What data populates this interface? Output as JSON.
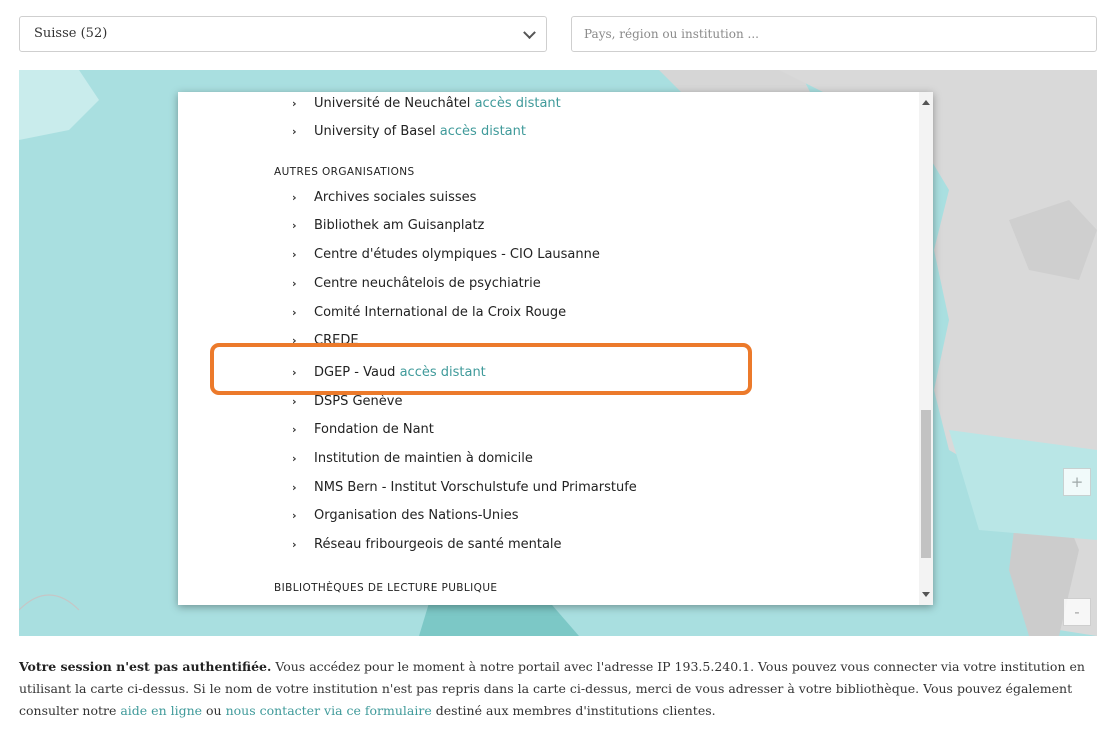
{
  "country_select": {
    "value": "Suisse (52)"
  },
  "search": {
    "placeholder": "Pays, région ou institution ..."
  },
  "map": {
    "zoom_in": "+",
    "zoom_out": "-"
  },
  "popup": {
    "items_top": [
      {
        "name": "Université de Neuchâtel",
        "remote": "accès distant"
      },
      {
        "name": "University of Basel",
        "remote": "accès distant"
      }
    ],
    "section_other": "AUTRES ORGANISATIONS",
    "items_other": [
      {
        "name": "Archives sociales suisses",
        "remote": ""
      },
      {
        "name": "Bibliothek am Guisanplatz",
        "remote": ""
      },
      {
        "name": "Centre d'études olympiques - CIO Lausanne",
        "remote": ""
      },
      {
        "name": "Centre neuchâtelois de psychiatrie",
        "remote": ""
      },
      {
        "name": "Comité International de la Croix Rouge",
        "remote": ""
      },
      {
        "name": "CREDE",
        "remote": ""
      },
      {
        "name": "DGEP - Vaud",
        "remote": "accès distant"
      },
      {
        "name": "DSPS Genève",
        "remote": ""
      },
      {
        "name": "Fondation de Nant",
        "remote": ""
      },
      {
        "name": "Institution de maintien à domicile",
        "remote": ""
      },
      {
        "name": "NMS Bern - Institut Vorschulstufe und Primarstufe",
        "remote": ""
      },
      {
        "name": "Organisation des Nations-Unies",
        "remote": ""
      },
      {
        "name": "Réseau fribourgeois de santé mentale",
        "remote": ""
      }
    ],
    "section_public": "BIBLIOTHÈQUES DE LECTURE PUBLIQUE"
  },
  "notice": {
    "bold": "Votre session n'est pas authentifiée.",
    "text1": " Vous accédez pour le moment à notre portail avec l'adresse IP 193.5.240.1. Vous pouvez vous connecter via votre institution en utilisant la carte ci-dessus. Si le nom de votre institution n'est pas repris dans la carte ci-dessus, merci de vous adresser à votre bibliothèque. Vous pouvez également consulter notre ",
    "link1": "aide en ligne",
    "text2": " ou ",
    "link2": "nous contacter via ce formulaire",
    "text3": " destiné aux membres d'institutions clientes."
  },
  "colors": {
    "accent": "#3f9a9a",
    "highlight": "#ec7a2b",
    "sea": "#a9dfe0",
    "land": "#d9d9d9"
  }
}
